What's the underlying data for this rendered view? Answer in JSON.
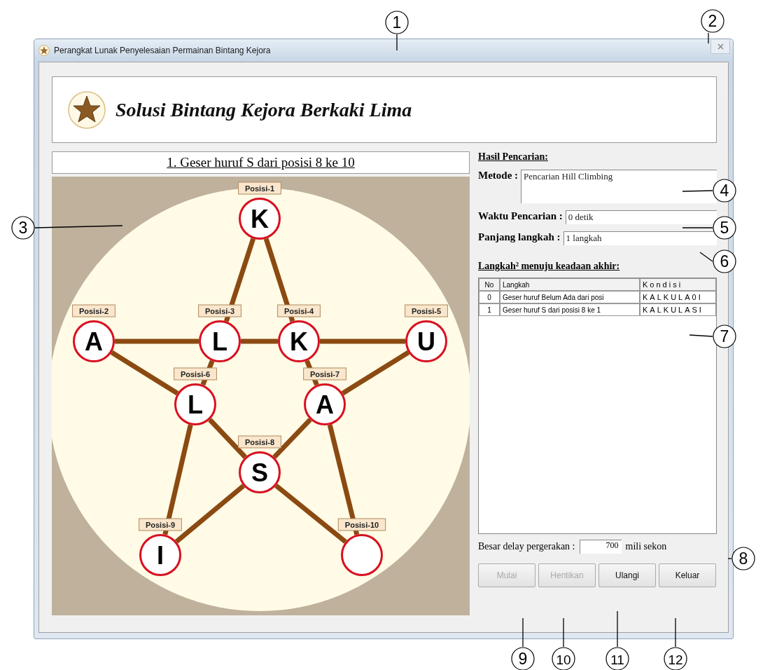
{
  "window": {
    "title": "Perangkat Lunak Penyelesaian Permainan Bintang Kejora"
  },
  "header": {
    "title": "Solusi Bintang Kejora Berkaki Lima"
  },
  "board": {
    "caption": "1. Geser huruf S dari posisi 8 ke 10",
    "positions": [
      {
        "label": "Posisi-1",
        "letter": "K"
      },
      {
        "label": "Posisi-2",
        "letter": "A"
      },
      {
        "label": "Posisi-3",
        "letter": "L"
      },
      {
        "label": "Posisi-4",
        "letter": "K"
      },
      {
        "label": "Posisi-5",
        "letter": "U"
      },
      {
        "label": "Posisi-6",
        "letter": "L"
      },
      {
        "label": "Posisi-7",
        "letter": "A"
      },
      {
        "label": "Posisi-8",
        "letter": "S"
      },
      {
        "label": "Posisi-9",
        "letter": "I"
      },
      {
        "label": "Posisi-10"
      }
    ]
  },
  "results": {
    "heading": "Hasil Pencarian:",
    "fields": [
      {
        "label": "Metode :",
        "value": "Pencarian Hill Climbing",
        "kind": "multiline"
      },
      {
        "label": "Waktu Pencarian :",
        "value": "0 detik",
        "kind": "line"
      },
      {
        "label": "Panjang langkah  :",
        "value": "1 langkah",
        "kind": "line"
      }
    ]
  },
  "steps": {
    "heading": "Langkah² menuju keadaan akhir:",
    "columns": [
      "No",
      "Langkah",
      "Kondisi"
    ],
    "rows": [
      [
        "0",
        "Geser huruf Belum Ada dari posi",
        "KALKULA0I"
      ],
      [
        "1",
        "Geser huruf S dari posisi 8 ke 1",
        "KALKULASI"
      ]
    ]
  },
  "delay": {
    "label": "Besar delay pergerakan :",
    "value": "700",
    "unit": "mili sekon"
  },
  "buttons": [
    {
      "label": "Mulai",
      "disabled": true
    },
    {
      "label": "Hentikan",
      "disabled": true
    },
    {
      "label": "Ulangi",
      "disabled": false
    },
    {
      "label": "Keluar",
      "disabled": false
    }
  ],
  "callouts": [
    "1",
    "2",
    "3",
    "4",
    "5",
    "6",
    "7",
    "8",
    "9",
    "10",
    "11",
    "12"
  ]
}
